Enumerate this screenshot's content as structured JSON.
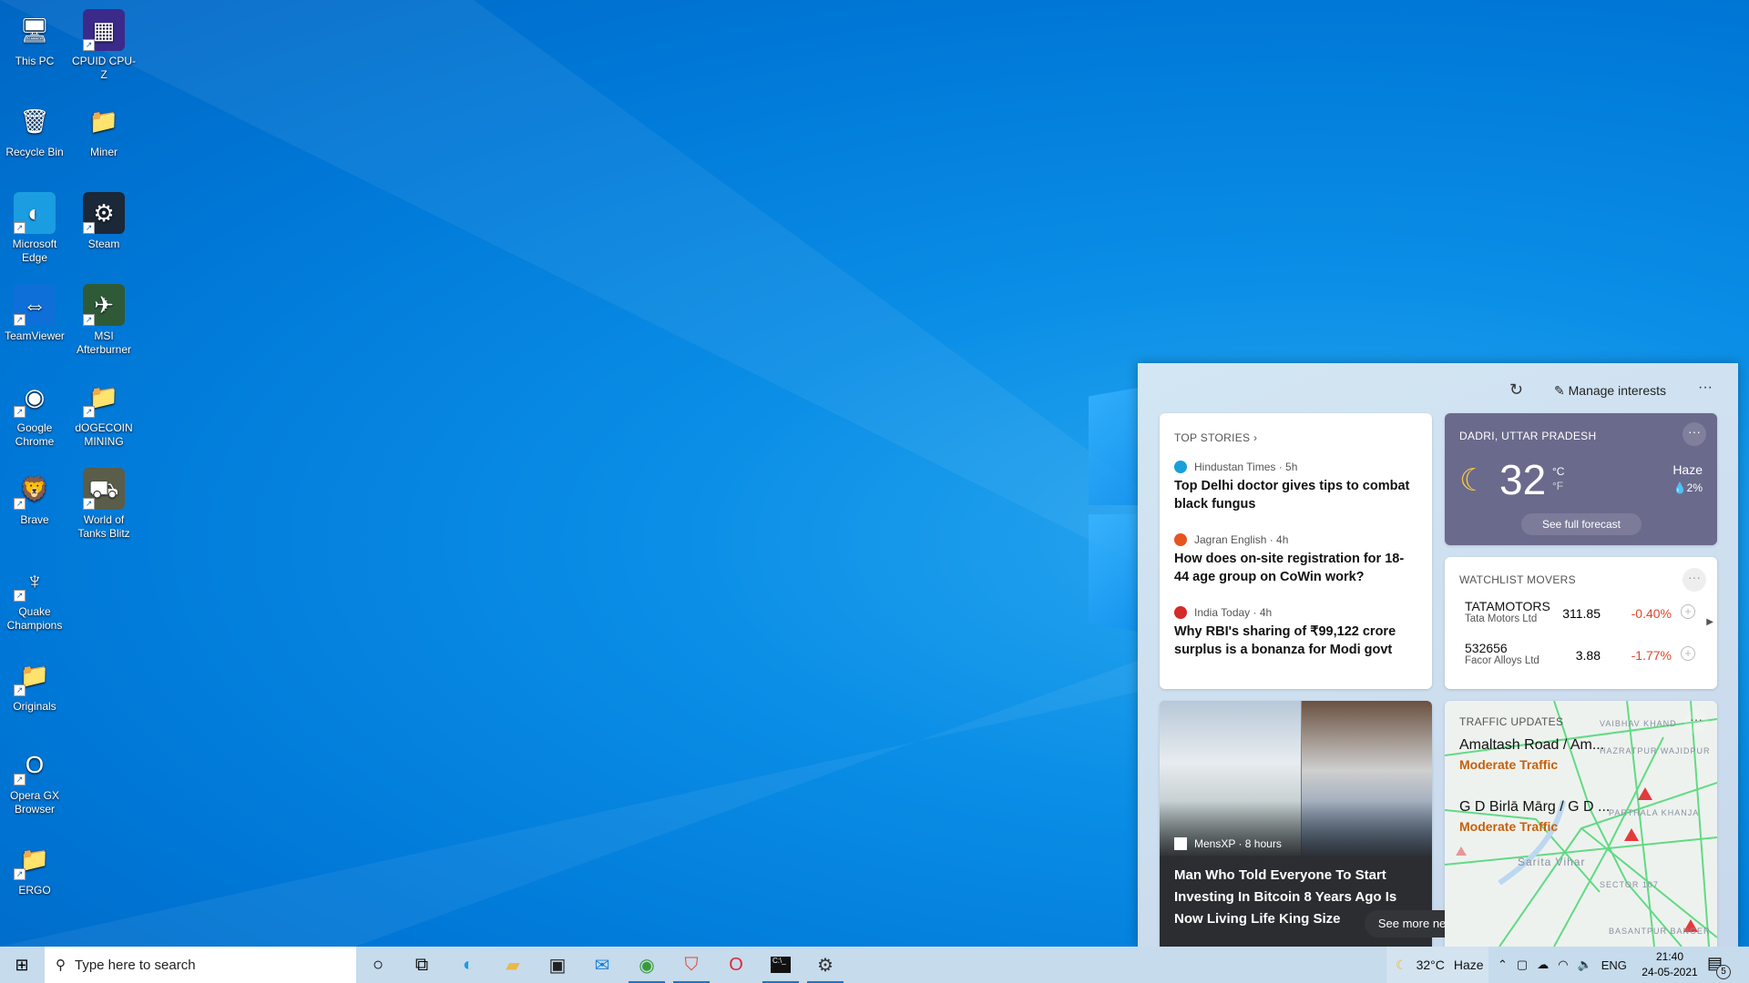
{
  "desktop": {
    "icons": [
      {
        "label": "This PC",
        "icon": "computer-icon",
        "glyph": "🖥",
        "bg": "transparent"
      },
      {
        "label": "CPUID CPU-Z",
        "icon": "cpu-z-icon",
        "glyph": "▦",
        "bg": "#3b2a8a"
      },
      {
        "label": "Recycle Bin",
        "icon": "recycle-bin-icon",
        "glyph": "🗑",
        "bg": "transparent"
      },
      {
        "label": "Miner",
        "icon": "folder-icon",
        "glyph": "📁",
        "bg": "transparent"
      },
      {
        "label": "Microsoft Edge",
        "icon": "edge-icon",
        "glyph": "◐",
        "bg": "#1b9de2"
      },
      {
        "label": "Steam",
        "icon": "steam-icon",
        "glyph": "⚙",
        "bg": "#1b2838"
      },
      {
        "label": "TeamViewer",
        "icon": "teamviewer-icon",
        "glyph": "⇔",
        "bg": "#0e6fd8"
      },
      {
        "label": "MSI Afterburner",
        "icon": "msi-afterburner-icon",
        "glyph": "✈",
        "bg": "#2f5a37"
      },
      {
        "label": "Google Chrome",
        "icon": "chrome-icon",
        "glyph": "◉",
        "bg": "transparent"
      },
      {
        "label": "dOGECOIN MINING",
        "icon": "folder-icon",
        "glyph": "📁",
        "bg": "transparent"
      },
      {
        "label": "Brave",
        "icon": "brave-icon",
        "glyph": "🦁",
        "bg": "transparent"
      },
      {
        "label": "World of Tanks Blitz",
        "icon": "world-of-tanks-icon",
        "glyph": "⛟",
        "bg": "#5a5d4a"
      },
      {
        "label": "Quake Champions",
        "icon": "quake-icon",
        "glyph": "♆",
        "bg": "transparent"
      },
      {
        "label": "Originals",
        "icon": "folder-icon",
        "glyph": "📁",
        "bg": "transparent"
      },
      {
        "label": "Opera GX Browser",
        "icon": "opera-gx-icon",
        "glyph": "O",
        "bg": "transparent"
      },
      {
        "label": "ERGO",
        "icon": "folder-icon",
        "glyph": "📁",
        "bg": "transparent"
      }
    ]
  },
  "widget": {
    "manage_interests": "Manage interests",
    "top_stories": {
      "header": "TOP STORIES",
      "items": [
        {
          "source": "Hindustan Times · 5h",
          "title": "Top Delhi doctor gives tips to combat black fungus",
          "color": "#1aa0d8"
        },
        {
          "source": "Jagran English · 4h",
          "title": "How does on-site registration for 18-44 age group on CoWin work?",
          "color": "#e8541f"
        },
        {
          "source": "India Today · 4h",
          "title": "Why RBI's sharing of ₹99,122 crore surplus is a bonanza for Modi govt",
          "color": "#d42a2a"
        }
      ]
    },
    "weather": {
      "location": "DADRI, UTTAR PRADESH",
      "temp": "32",
      "unit_c": "°C",
      "unit_f": "°F",
      "condition": "Haze",
      "precip": "💧2%",
      "forecast_button": "See full forecast"
    },
    "watchlist": {
      "header": "WATCHLIST MOVERS",
      "stocks": [
        {
          "symbol": "TATAMOTORS",
          "name": "Tata Motors Ltd",
          "price": "311.85",
          "change": "-0.40%"
        },
        {
          "symbol": "532656",
          "name": "Facor Alloys Ltd",
          "price": "3.88",
          "change": "-1.77%"
        }
      ]
    },
    "feature": {
      "source": "MensXP · 8 hours",
      "title": "Man Who Told Everyone To Start Investing In Bitcoin 8 Years Ago Is Now Living Life King Size",
      "see_more": "See more news"
    },
    "traffic": {
      "header": "TRAFFIC UPDATES",
      "routes": [
        {
          "road": "Amaltash Road / Am...",
          "status": "Moderate Traffic"
        },
        {
          "road": "G D Birlā Mārg / G D ...",
          "status": "Moderate Traffic"
        }
      ],
      "map_labels": [
        "Sarita Vihar",
        "VAIBHAV KHAND",
        "HAZRATPUR WAJIDPUR",
        "PARTHALA KHANJA",
        "SECTOR 107",
        "BASANTPUR BANGER"
      ]
    },
    "colors": {
      "negative": "#e0452b",
      "traffic": "#c8600a"
    }
  },
  "taskbar": {
    "search_placeholder": "Type here to search",
    "weather": "32°C",
    "weather_cond": "Haze",
    "lang": "ENG",
    "time": "21:40",
    "date": "24-05-2021",
    "notifications": "5"
  }
}
